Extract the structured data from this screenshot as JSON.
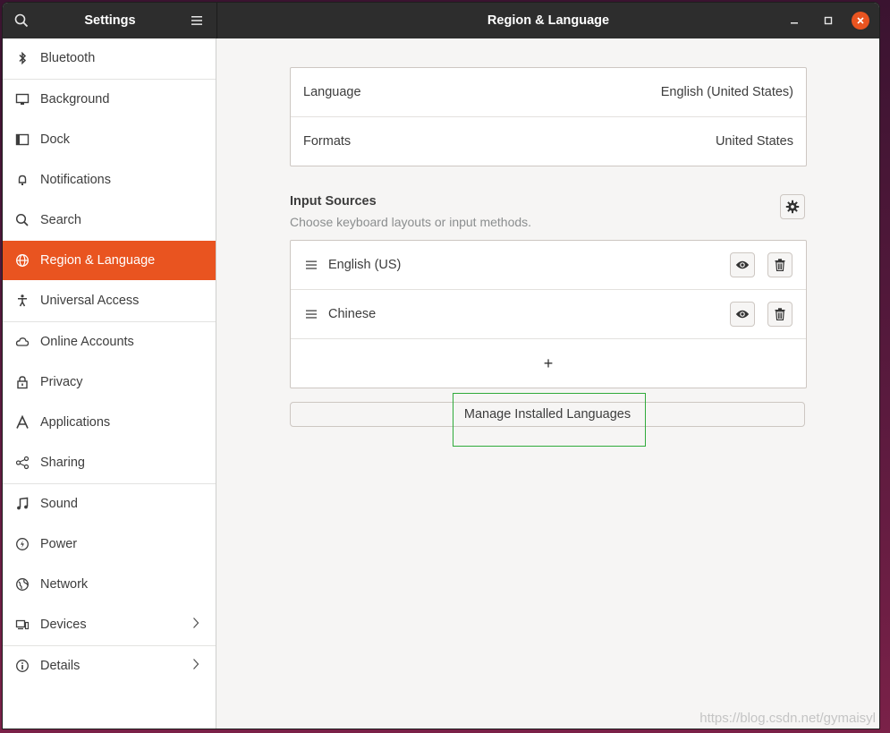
{
  "titlebar": {
    "app_title": "Settings",
    "page_title": "Region & Language"
  },
  "sidebar": {
    "items": [
      {
        "label": "Bluetooth",
        "icon": "bluetooth-icon"
      },
      {
        "label": "Background",
        "icon": "background-icon"
      },
      {
        "label": "Dock",
        "icon": "dock-icon"
      },
      {
        "label": "Notifications",
        "icon": "bell-icon"
      },
      {
        "label": "Search",
        "icon": "search-icon"
      },
      {
        "label": "Region & Language",
        "icon": "globe-icon",
        "active": true
      },
      {
        "label": "Universal Access",
        "icon": "accessibility-icon"
      },
      {
        "label": "Online Accounts",
        "icon": "cloud-icon"
      },
      {
        "label": "Privacy",
        "icon": "lock-icon"
      },
      {
        "label": "Applications",
        "icon": "applications-icon"
      },
      {
        "label": "Sharing",
        "icon": "share-icon"
      },
      {
        "label": "Sound",
        "icon": "music-note-icon"
      },
      {
        "label": "Power",
        "icon": "power-icon"
      },
      {
        "label": "Network",
        "icon": "network-icon"
      },
      {
        "label": "Devices",
        "icon": "devices-icon",
        "chevron": true
      },
      {
        "label": "Details",
        "icon": "info-icon",
        "chevron": true
      }
    ]
  },
  "region": {
    "language_label": "Language",
    "language_value": "English (United States)",
    "formats_label": "Formats",
    "formats_value": "United States"
  },
  "input_sources": {
    "title": "Input Sources",
    "subtitle": "Choose keyboard layouts or input methods.",
    "sources": [
      {
        "label": "English (US)"
      },
      {
        "label": "Chinese"
      }
    ],
    "add_label": "+"
  },
  "manage_button": "Manage Installed Languages",
  "watermark": "https://blog.csdn.net/gymaisyl",
  "colors": {
    "accent": "#e95420",
    "titlebar": "#2d2d2d",
    "highlight": "#2faa3a"
  }
}
